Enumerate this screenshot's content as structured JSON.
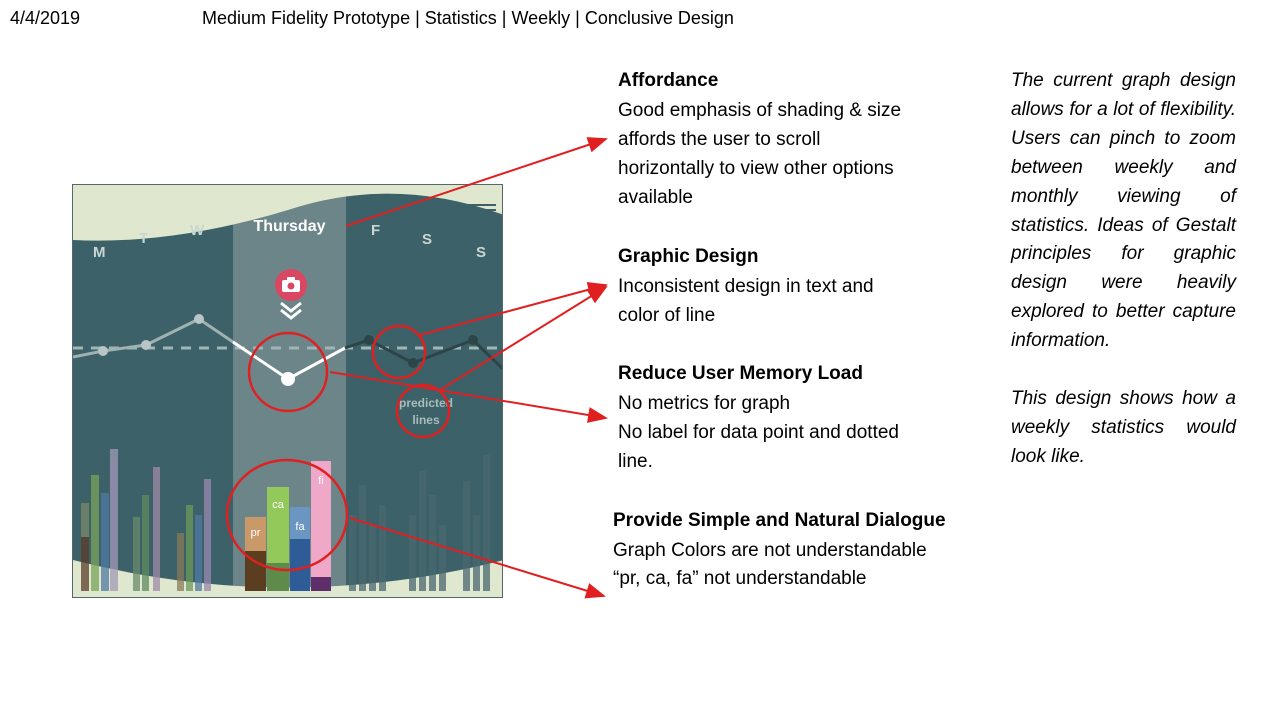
{
  "header": {
    "date": "4/4/2019",
    "title": "Medium Fidelity Prototype | Statistics | Weekly | Conclusive Design"
  },
  "mockup": {
    "days": [
      "M",
      "T",
      "W",
      "Thursday",
      "F",
      "S",
      "S"
    ],
    "bar_labels": [
      "pr",
      "ca",
      "fa",
      "fi"
    ],
    "predicted_label_line1": "predicted",
    "predicted_label_line2": "lines",
    "colors": {
      "background": "#3d6168",
      "selected_column": "#6b8589",
      "top_band": "#dfe8cf",
      "camera_button": "#d94763",
      "pr": "#c9996a",
      "ca": "#92c95a",
      "fa": "#6b96c2",
      "fi": "#f0a8c8"
    }
  },
  "annotations": [
    {
      "heading": "Affordance",
      "lines": [
        "Good emphasis of shading & size",
        "affords the user to scroll",
        "horizontally to view other options",
        "available"
      ]
    },
    {
      "heading": "Graphic Design",
      "lines": [
        "Inconsistent design in text and",
        "color of line"
      ]
    },
    {
      "heading": "Reduce User Memory Load",
      "lines": [
        "No metrics for graph",
        "No label for data point and dotted",
        "line."
      ]
    },
    {
      "heading": "Provide Simple and Natural Dialogue",
      "lines": [
        "Graph Colors are not understandable",
        "“pr, ca, fa” not understandable"
      ]
    }
  ],
  "side_note": {
    "paragraph1": "The current graph design allows for a lot of flexibility. Users can pinch to zoom between weekly and monthly viewing of statistics. Ideas of Gestalt principles for graphic design were heavily explored to better capture information.",
    "paragraph2": "This design shows how a weekly statistics would look like."
  }
}
